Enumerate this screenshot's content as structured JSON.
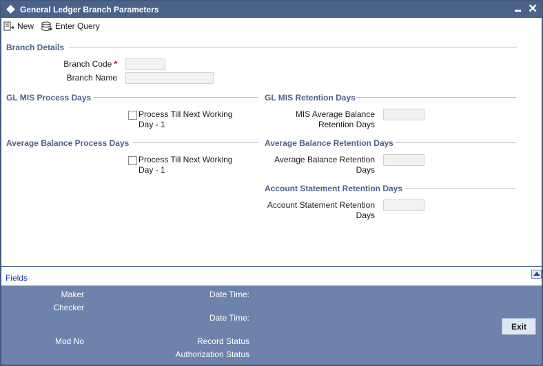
{
  "window": {
    "title": "General Ledger Branch Parameters"
  },
  "toolbar": {
    "new_label": "New",
    "enter_query_label": "Enter Query"
  },
  "branch_details": {
    "section_title": "Branch Details",
    "branch_code_label": "Branch Code",
    "required_marker": "*",
    "branch_code_value": "",
    "branch_name_label": "Branch Name",
    "branch_name_value": ""
  },
  "gl_mis_process": {
    "section_title": "GL MIS Process Days",
    "checkbox_line1": "Process Till Next Working",
    "checkbox_line2": "Day - 1",
    "checked": false
  },
  "gl_mis_retention": {
    "section_title": "GL MIS Retention Days",
    "label_line1": "MIS Average Balance",
    "label_line2": "Retention Days",
    "value": ""
  },
  "avg_balance_process": {
    "section_title": "Average Balance Process Days",
    "checkbox_line1": "Process Till Next Working",
    "checkbox_line2": "Day - 1",
    "checked": false
  },
  "avg_balance_retention": {
    "section_title": "Average Balance Retention Days",
    "label_line1": "Average Balance Retention",
    "label_line2": "Days",
    "value": ""
  },
  "account_statement_retention": {
    "section_title": "Account Statement Retention Days",
    "label_line1": "Account Statement Retention",
    "label_line2": "Days",
    "value": ""
  },
  "fields_bar": {
    "label": "Fields"
  },
  "footer": {
    "maker": "Maker",
    "checker": "Checker",
    "mod_no": "Mod No",
    "date_time_1": "Date Time:",
    "date_time_2": "Date Time:",
    "record_status": "Record Status",
    "authorization_status": "Authorization Status",
    "exit_label": "Exit"
  },
  "colors": {
    "title_bar": "#4b6289",
    "section_heading": "#4b6289",
    "footer_bg": "#6e83ab",
    "required": "#cc0000"
  }
}
